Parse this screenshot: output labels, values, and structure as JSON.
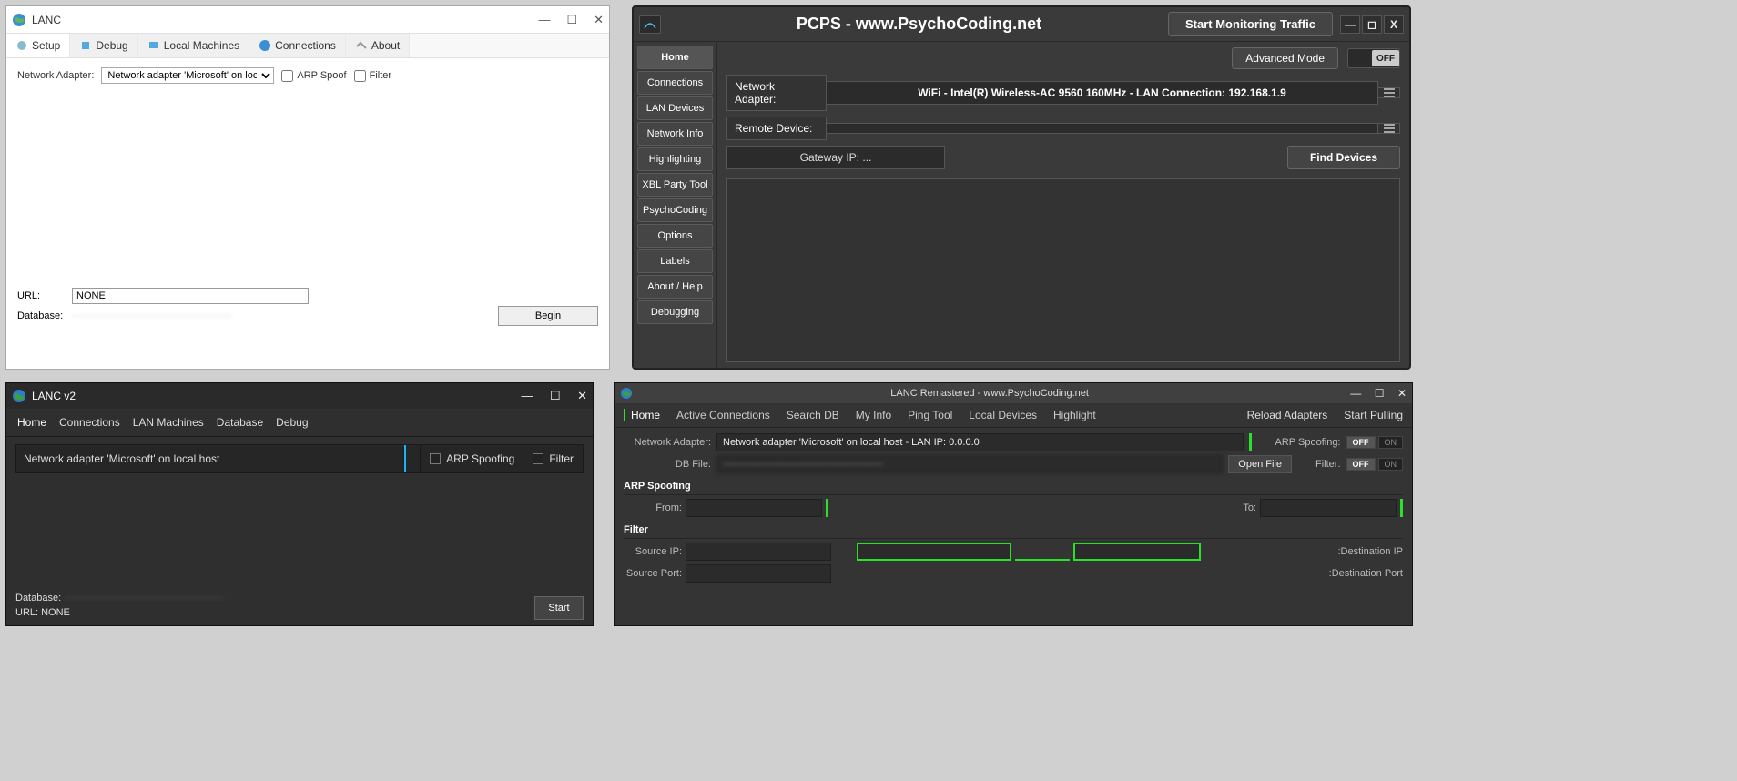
{
  "win1": {
    "title": "LANC",
    "tabs": [
      "Setup",
      "Debug",
      "Local Machines",
      "Connections",
      "About"
    ],
    "adapter_label": "Network Adapter:",
    "adapter_value": "Network adapter 'Microsoft' on local host",
    "arp_label": "ARP Spoof",
    "filter_label": "Filter",
    "url_label": "URL:",
    "url_value": "NONE",
    "db_label": "Database:",
    "db_value": "················································",
    "begin": "Begin"
  },
  "win2": {
    "title": "PCPS - www.PsychoCoding.net",
    "monitor": "Start Monitoring Traffic",
    "sidebar": [
      "Home",
      "Connections",
      "LAN Devices",
      "Network Info",
      "Highlighting",
      "XBL Party Tool",
      "PsychoCoding",
      "Options",
      "Labels",
      "About / Help",
      "Debugging"
    ],
    "adv": "Advanced Mode",
    "toggle": "OFF",
    "adapter_label": "Network Adapter:",
    "adapter_value": "WiFi - Intel(R) Wireless-AC 9560 160MHz - LAN Connection: 192.168.1.9",
    "remote_label": "Remote Device:",
    "remote_value": "",
    "gateway": "Gateway IP: ...",
    "find": "Find Devices"
  },
  "win3": {
    "title": "LANC v2",
    "tabs": [
      "Home",
      "Connections",
      "LAN Machines",
      "Database",
      "Debug"
    ],
    "adapter_value": "Network adapter 'Microsoft' on local host",
    "arp_label": "ARP Spoofing",
    "filter_label": "Filter",
    "db_label": "Database:",
    "db_value": "················································",
    "url_line": "URL: NONE",
    "start": "Start"
  },
  "win4": {
    "title": "LANC Remastered - www.PsychoCoding.net",
    "tabs": [
      "Home",
      "Active Connections",
      "Search DB",
      "My Info",
      "Ping Tool",
      "Local Devices",
      "Highlight"
    ],
    "reload": "Reload Adapters",
    "startpull": "Start Pulling",
    "adapter_label": "Network Adapter:",
    "adapter_value": "Network adapter 'Microsoft' on local host - LAN IP: 0.0.0.0",
    "arp_label": "ARP Spoofing:",
    "filter_label": "Filter:",
    "off": "OFF",
    "on": "ON",
    "db_label": "DB File:",
    "db_value": "················································",
    "open": "Open File",
    "section_arp": "ARP Spoofing",
    "from": "From:",
    "to": "To:",
    "section_filter": "Filter",
    "srcip": "Source IP:",
    "srcport": "Source Port:",
    "destip": ":Destination IP",
    "destport": ":Destination Port"
  }
}
